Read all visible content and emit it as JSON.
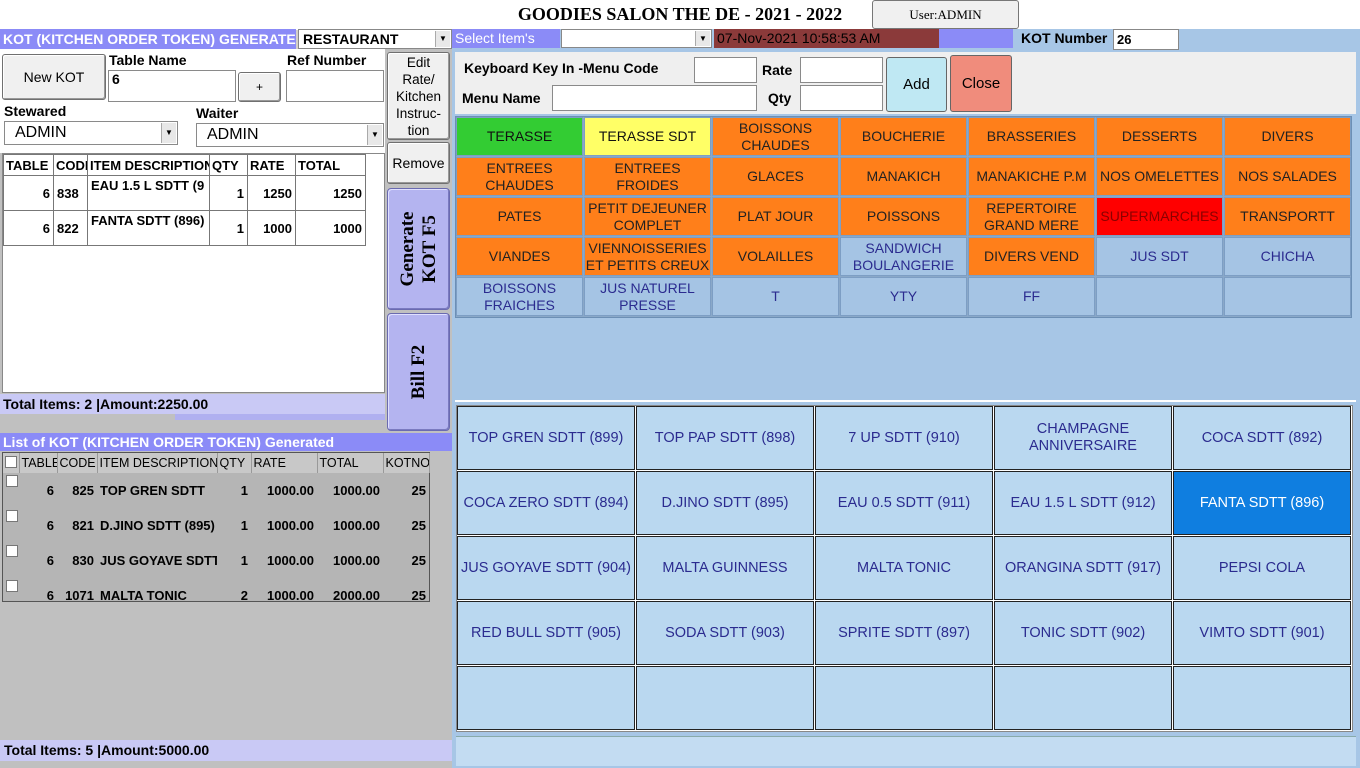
{
  "window": {
    "title": "GOODIES SALON THE DE - 2021 - 2022",
    "user": "User:ADMIN"
  },
  "kot_form": {
    "header": "KOT  (KITCHEN ORDER TOKEN) GENERATE",
    "type_value": "RESTAURANT",
    "new_kot_label": "New KOT",
    "table_name_label": "Table Name",
    "table_name_value": "6",
    "plus_label": "+",
    "ref_number_label": "Ref Number",
    "ref_number_value": "",
    "stewared_label": "Stewared",
    "stewared_value": "ADMIN",
    "waiter_label": "Waiter",
    "waiter_value": "ADMIN"
  },
  "kot_grid": {
    "columns": [
      "TABLE",
      "CODE",
      "ITEM DESCRIPTION",
      "QTY",
      "RATE",
      "TOTAL"
    ],
    "rows": [
      {
        "table": "6",
        "code": "838",
        "desc": "EAU 1.5 L SDTT (9",
        "qty": "1",
        "rate": "1250",
        "total": "1250"
      },
      {
        "table": "6",
        "code": "822",
        "desc": "FANTA SDTT (896)",
        "qty": "1",
        "rate": "1000",
        "total": "1000"
      }
    ],
    "totals": "Total Items: 2     |Amount:2250.00"
  },
  "side_buttons": {
    "edit": "Edit Rate/ Kitchen Instruc- tion",
    "remove": "Remove",
    "generate": "Generate KOT F5",
    "bill": "Bill F2"
  },
  "kot_list": {
    "header": "List of KOT  (KITCHEN ORDER TOKEN) Generated",
    "columns": [
      "TABLE",
      "CODE",
      "ITEM DESCRIPTION",
      "QTY",
      "RATE",
      "TOTAL",
      "KOTNO"
    ],
    "rows": [
      {
        "table": "6",
        "code": "825",
        "desc": "TOP GREN SDTT",
        "qty": "1",
        "rate": "1000.00",
        "total": "1000.00",
        "kotno": "25"
      },
      {
        "table": "6",
        "code": "821",
        "desc": "D.JINO SDTT (895)",
        "qty": "1",
        "rate": "1000.00",
        "total": "1000.00",
        "kotno": "25"
      },
      {
        "table": "6",
        "code": "830",
        "desc": "JUS GOYAVE SDTT",
        "qty": "1",
        "rate": "1000.00",
        "total": "1000.00",
        "kotno": "25"
      },
      {
        "table": "6",
        "code": "1071",
        "desc": "MALTA TONIC",
        "qty": "2",
        "rate": "1000.00",
        "total": "2000.00",
        "kotno": "25"
      }
    ],
    "totals": "Total Items: 5     |Amount:5000.00"
  },
  "top_bar": {
    "select_label": "Select Item's",
    "select_value": "",
    "datetime": "07-Nov-2021 10:58:53 AM",
    "kot_number_label": "KOT Number",
    "kot_number": "26"
  },
  "keyin": {
    "menu_code_label": "Keyboard Key In -Menu Code",
    "menu_code_value": "",
    "rate_label": "Rate",
    "rate_value": "",
    "menu_name_label": "Menu Name",
    "menu_name_value": "",
    "qty_label": "Qty",
    "qty_value": "",
    "add_label": "Add",
    "close_label": "Close"
  },
  "categories": [
    {
      "label": "TERASSE",
      "style": "green"
    },
    {
      "label": "TERASSE SDT",
      "style": "yellow"
    },
    {
      "label": "BOISSONS CHAUDES",
      "style": "orange"
    },
    {
      "label": "BOUCHERIE",
      "style": "orange"
    },
    {
      "label": "BRASSERIES",
      "style": "orange"
    },
    {
      "label": "DESSERTS",
      "style": "orange"
    },
    {
      "label": "DIVERS",
      "style": "orange"
    },
    {
      "label": "ENTREES CHAUDES",
      "style": "orange"
    },
    {
      "label": "ENTREES FROIDES",
      "style": "orange"
    },
    {
      "label": "GLACES",
      "style": "orange"
    },
    {
      "label": "MANAKICH",
      "style": "orange"
    },
    {
      "label": "MANAKICHE P.M",
      "style": "orange"
    },
    {
      "label": "NOS OMELETTES",
      "style": "orange"
    },
    {
      "label": "NOS SALADES",
      "style": "orange"
    },
    {
      "label": "PATES",
      "style": "orange"
    },
    {
      "label": "PETIT DEJEUNER COMPLET",
      "style": "orange"
    },
    {
      "label": "PLAT JOUR",
      "style": "orange"
    },
    {
      "label": "POISSONS",
      "style": "orange"
    },
    {
      "label": "REPERTOIRE GRAND MERE",
      "style": "orange"
    },
    {
      "label": "SUPERMARCHES",
      "style": "red"
    },
    {
      "label": "TRANSPORTT",
      "style": "orange"
    },
    {
      "label": "VIANDES",
      "style": "orange"
    },
    {
      "label": "VIENNOISSERIES ET PETITS CREUX",
      "style": "orange"
    },
    {
      "label": "VOLAILLES",
      "style": "orange"
    },
    {
      "label": "SANDWICH BOULANGERIE",
      "style": "blue"
    },
    {
      "label": "DIVERS VEND",
      "style": "orange"
    },
    {
      "label": "JUS SDT",
      "style": "blue"
    },
    {
      "label": "CHICHA",
      "style": "blue"
    },
    {
      "label": "BOISSONS FRAICHES",
      "style": "blue"
    },
    {
      "label": "JUS NATUREL PRESSE",
      "style": "blue"
    },
    {
      "label": "T",
      "style": "blue"
    },
    {
      "label": "YTY",
      "style": "blue"
    },
    {
      "label": "FF",
      "style": "blue"
    },
    {
      "label": "",
      "style": "blue"
    },
    {
      "label": "",
      "style": "blue"
    }
  ],
  "items": [
    {
      "label": "TOP GREN SDTT (899)",
      "selected": false
    },
    {
      "label": "TOP PAP SDTT (898)",
      "selected": false
    },
    {
      "label": "7 UP SDTT (910)",
      "selected": false
    },
    {
      "label": "CHAMPAGNE ANNIVERSAIRE",
      "selected": false
    },
    {
      "label": "COCA  SDTT (892)",
      "selected": false
    },
    {
      "label": "COCA ZERO SDTT (894)",
      "selected": false
    },
    {
      "label": "D.JINO SDTT (895)",
      "selected": false
    },
    {
      "label": "EAU 0.5 SDTT (911)",
      "selected": false
    },
    {
      "label": "EAU 1.5 L SDTT (912)",
      "selected": false
    },
    {
      "label": "FANTA SDTT (896)",
      "selected": true
    },
    {
      "label": "JUS GOYAVE SDTT (904)",
      "selected": false
    },
    {
      "label": "MALTA GUINNESS",
      "selected": false
    },
    {
      "label": "MALTA TONIC",
      "selected": false
    },
    {
      "label": "ORANGINA  SDTT (917)",
      "selected": false
    },
    {
      "label": "PEPSI COLA",
      "selected": false
    },
    {
      "label": "RED BULL SDTT (905)",
      "selected": false
    },
    {
      "label": "SODA SDTT (903)",
      "selected": false
    },
    {
      "label": "SPRITE SDTT (897)",
      "selected": false
    },
    {
      "label": "TONIC SDTT (902)",
      "selected": false
    },
    {
      "label": "VIMTO SDTT (901)",
      "selected": false
    },
    {
      "label": "",
      "selected": false
    },
    {
      "label": "",
      "selected": false
    },
    {
      "label": "",
      "selected": false
    },
    {
      "label": "",
      "selected": false
    },
    {
      "label": "",
      "selected": false
    }
  ]
}
